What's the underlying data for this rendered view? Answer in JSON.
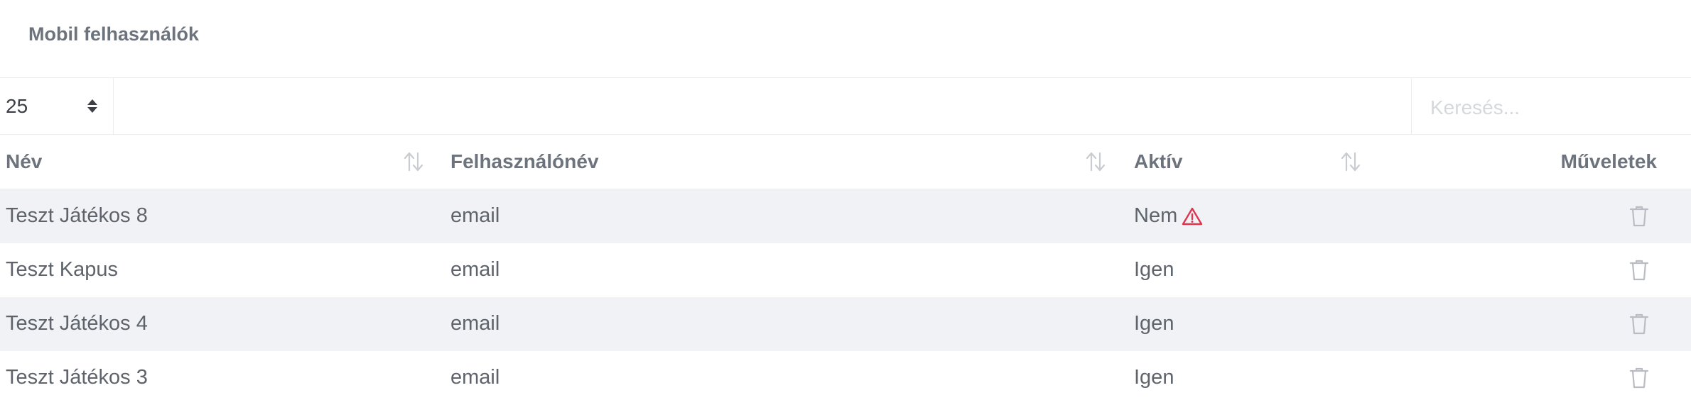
{
  "card": {
    "title": "Mobil felhasználók"
  },
  "toolbar": {
    "page_length": "25",
    "search_placeholder": "Keresés..."
  },
  "table": {
    "columns": [
      {
        "label": "Név",
        "sortable": true
      },
      {
        "label": "Felhasználónév",
        "sortable": true
      },
      {
        "label": "Aktív",
        "sortable": true
      },
      {
        "label": "Műveletek",
        "sortable": false
      }
    ],
    "rows": [
      {
        "name": "Teszt Játékos 8",
        "username": "email",
        "active": "Nem",
        "warning": true
      },
      {
        "name": "Teszt Kapus",
        "username": "email",
        "active": "Igen",
        "warning": false
      },
      {
        "name": "Teszt Játékos 4",
        "username": "email",
        "active": "Igen",
        "warning": false
      },
      {
        "name": "Teszt Játékos 3",
        "username": "email",
        "active": "Igen",
        "warning": false
      }
    ]
  },
  "colors": {
    "warning": "#e0344e",
    "striped_row": "#f1f2f6",
    "icon_gray": "#b9bdc3"
  },
  "icons": {
    "sort": "sort-arrows-icon",
    "warning": "warning-triangle-icon",
    "delete": "trash-icon"
  }
}
